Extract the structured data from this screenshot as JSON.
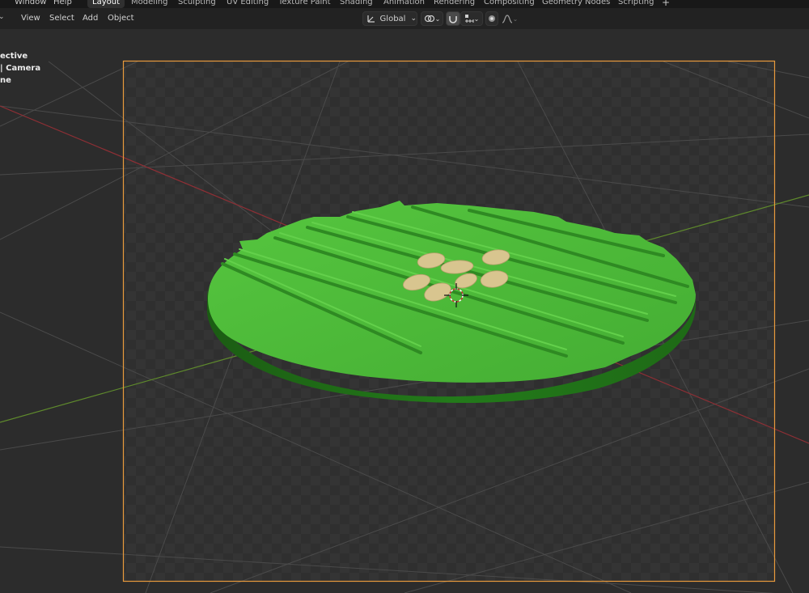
{
  "topbar": {
    "menus": [
      "Window",
      "Help"
    ],
    "workspace_tabs": [
      {
        "label": "Layout",
        "active": true
      },
      {
        "label": "Modeling",
        "active": false
      },
      {
        "label": "Sculpting",
        "active": false
      },
      {
        "label": "UV Editing",
        "active": false
      },
      {
        "label": "Texture Paint",
        "active": false
      },
      {
        "label": "Shading",
        "active": false
      },
      {
        "label": "Animation",
        "active": false
      },
      {
        "label": "Rendering",
        "active": false
      },
      {
        "label": "Compositing",
        "active": false
      },
      {
        "label": "Geometry Nodes",
        "active": false
      },
      {
        "label": "Scripting",
        "active": false
      }
    ],
    "add_tab_label": "+"
  },
  "viewport_header": {
    "menus": [
      "View",
      "Select",
      "Add",
      "Object"
    ],
    "transform_orientation": "Global",
    "icons": [
      "transform-orientation-icon",
      "pivot-point-icon",
      "snap-icon",
      "snap-target-icon",
      "proportional-editing-icon",
      "falloff-icon"
    ]
  },
  "viewport_overlay": {
    "view_label": "User Perspective",
    "visible_view_label": "ective",
    "camera_label": "| Camera",
    "object_label": "ne"
  },
  "colors": {
    "grid_bg": "#2f2f2f",
    "camera_frame": "#e89a3c",
    "x_axis": "#8e2f35",
    "y_axis": "#5f8a2c",
    "leaf_top": "#4fba3a",
    "leaf_side": "#1f6e16",
    "seed": "#d8c58f"
  }
}
